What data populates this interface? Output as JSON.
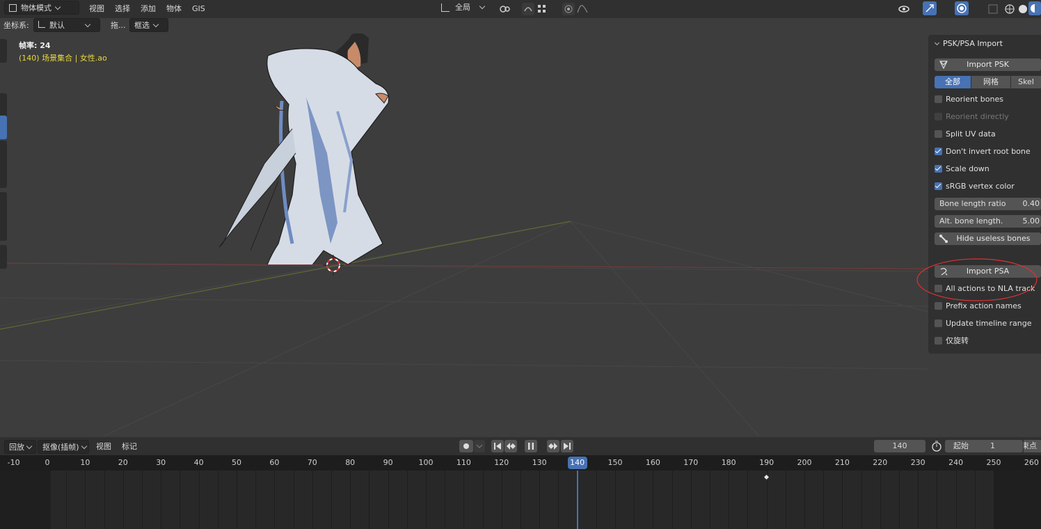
{
  "header": {
    "mode": "物体模式",
    "menus": [
      "视图",
      "选择",
      "添加",
      "物体",
      "GIS"
    ],
    "transform_orientation": "全局",
    "coord_label": "坐标系:",
    "coord_value": "默认",
    "drag_label": "拖...",
    "select_mode": "框选"
  },
  "viewport": {
    "fps_text": "帧率: 24",
    "collection_text": "(140) 场景集合 | 女性.ao"
  },
  "panel": {
    "title": "PSK/PSA Import",
    "import_psk": "Import PSK",
    "segments": [
      "全部",
      "网格",
      "Skel"
    ],
    "options_psk": [
      {
        "label": "Reorient bones",
        "checked": false,
        "enabled": true
      },
      {
        "label": "Reorient directly",
        "checked": false,
        "enabled": false
      },
      {
        "label": "Split UV data",
        "checked": false,
        "enabled": true
      },
      {
        "label": "Don't invert root bone",
        "checked": true,
        "enabled": true
      },
      {
        "label": "Scale down",
        "checked": true,
        "enabled": true
      },
      {
        "label": "sRGB vertex color",
        "checked": true,
        "enabled": true
      }
    ],
    "bone_length_ratio": {
      "label": "Bone length ratio",
      "value": "0.40"
    },
    "alt_bone_length": {
      "label": "Alt. bone length.",
      "value": "5.00"
    },
    "hide_useless": "Hide useless bones",
    "import_psa": "Import PSA",
    "options_psa": [
      {
        "label": "All actions to NLA track",
        "checked": false
      },
      {
        "label": "Prefix action names",
        "checked": false
      },
      {
        "label": "Update timeline range",
        "checked": false
      },
      {
        "label": "仅旋转",
        "checked": false
      }
    ]
  },
  "timeline": {
    "playback": "回放",
    "keying": "抠像(插帧)",
    "view": "视图",
    "marker": "标记",
    "current_frame": "140",
    "start_label": "起始",
    "start_value": "1",
    "end_label": "结束点",
    "ruler_ticks": [
      "-10",
      "0",
      "10",
      "20",
      "30",
      "40",
      "50",
      "60",
      "70",
      "80",
      "90",
      "100",
      "110",
      "120",
      "130",
      "140",
      "150",
      "160",
      "170",
      "180",
      "190",
      "200",
      "210",
      "220",
      "230",
      "240",
      "250",
      "260"
    ],
    "playhead_frame": "140",
    "keyframe_at": 190
  },
  "colors": {
    "accent": "#4772b3",
    "info_yellow": "#e8d83a",
    "annotation_red": "#e03030"
  }
}
